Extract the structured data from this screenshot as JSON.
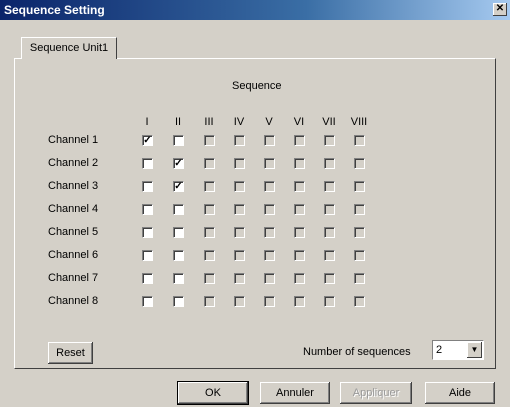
{
  "window": {
    "title": "Sequence Setting",
    "close_glyph": "✕"
  },
  "tab": {
    "label": "Sequence Unit1"
  },
  "sequence_header": "Sequence",
  "columns": [
    "I",
    "II",
    "III",
    "IV",
    "V",
    "VI",
    "VII",
    "VIII"
  ],
  "channels": [
    {
      "label": "Channel 1",
      "checked": [
        true,
        false,
        false,
        false,
        false,
        false,
        false,
        false
      ]
    },
    {
      "label": "Channel 2",
      "checked": [
        false,
        true,
        false,
        false,
        false,
        false,
        false,
        false
      ]
    },
    {
      "label": "Channel 3",
      "checked": [
        false,
        true,
        false,
        false,
        false,
        false,
        false,
        false
      ]
    },
    {
      "label": "Channel 4",
      "checked": [
        false,
        false,
        false,
        false,
        false,
        false,
        false,
        false
      ]
    },
    {
      "label": "Channel 5",
      "checked": [
        false,
        false,
        false,
        false,
        false,
        false,
        false,
        false
      ]
    },
    {
      "label": "Channel 6",
      "checked": [
        false,
        false,
        false,
        false,
        false,
        false,
        false,
        false
      ]
    },
    {
      "label": "Channel 7",
      "checked": [
        false,
        false,
        false,
        false,
        false,
        false,
        false,
        false
      ]
    },
    {
      "label": "Channel 8",
      "checked": [
        false,
        false,
        false,
        false,
        false,
        false,
        false,
        false
      ]
    }
  ],
  "enabled_columns": 2,
  "reset_label": "Reset",
  "number_of_sequences": {
    "label": "Number of sequences",
    "value": "2"
  },
  "buttons": {
    "ok": "OK",
    "cancel": "Annuler",
    "apply": "Appliquer",
    "help": "Aide"
  }
}
